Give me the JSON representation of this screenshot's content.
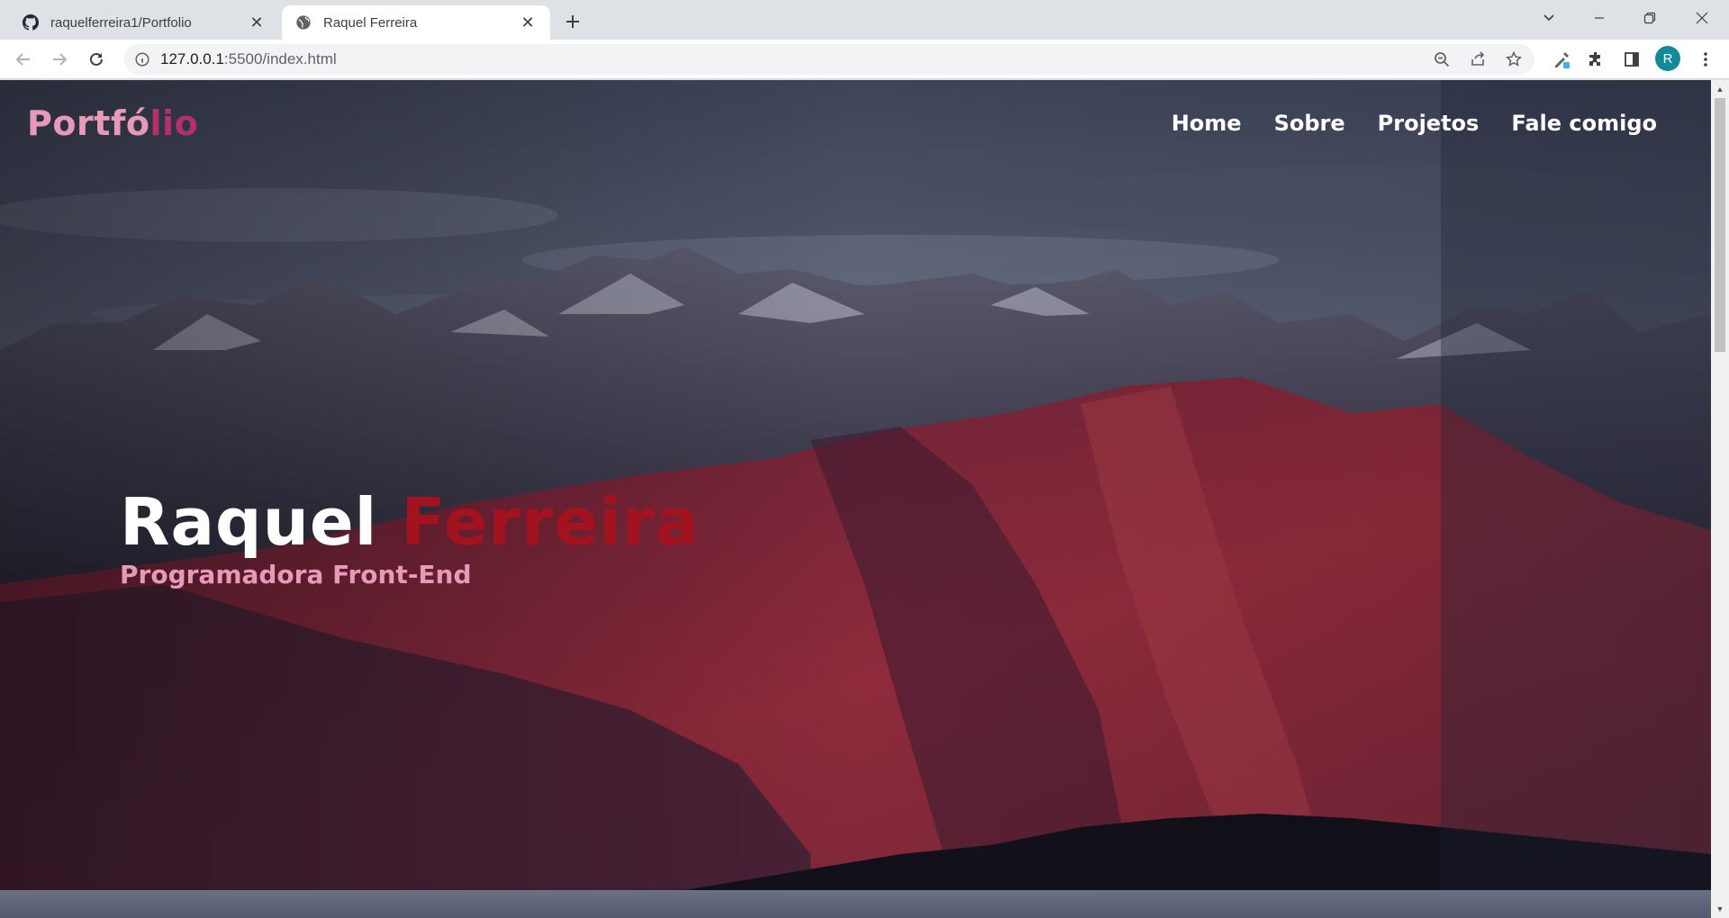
{
  "browser": {
    "tabs": [
      {
        "title": "raquelferreira1/Portfolio",
        "favicon": "github-icon",
        "active": false
      },
      {
        "title": "Raquel Ferreira",
        "favicon": "globe-icon",
        "active": true
      }
    ],
    "url_host": "127.0.0.1",
    "url_rest": ":5500/index.html",
    "profile_initial": "R",
    "profile_color": "#128a9a"
  },
  "site": {
    "logo_part1": "Portfó",
    "logo_part2": "lio",
    "nav": [
      {
        "label": "Home"
      },
      {
        "label": "Sobre"
      },
      {
        "label": "Projetos"
      },
      {
        "label": "Fale comigo"
      }
    ],
    "hero": {
      "first_name": "Raquel",
      "last_name": "Ferreira",
      "role": "Programadora Front-End"
    },
    "colors": {
      "logo_primary": "#e79ab8",
      "logo_accent": "#b4306a",
      "name_accent": "#a3121f",
      "role": "#e79ab8"
    }
  }
}
